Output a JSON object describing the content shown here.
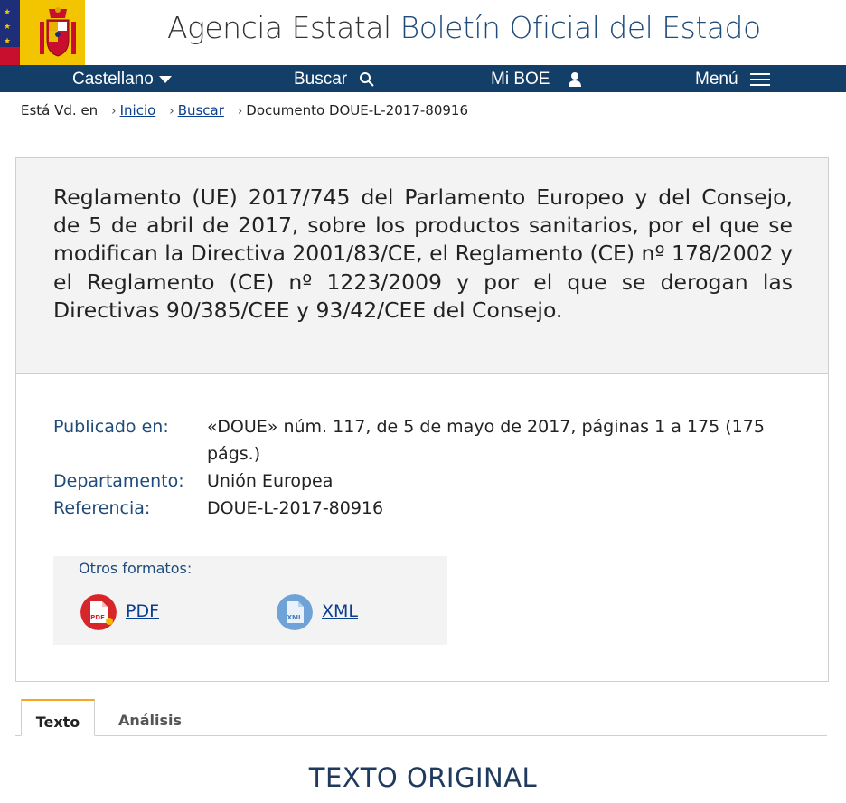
{
  "header": {
    "title_main": "Agencia Estatal",
    "title_accent": "Boletín Oficial del Estado"
  },
  "nav": {
    "language": "Castellano",
    "search": "Buscar",
    "my_boe": "Mi BOE",
    "menu": "Menú"
  },
  "breadcrumb": {
    "prefix": "Está Vd. en",
    "items": [
      "Inicio",
      "Buscar",
      "Documento DOUE-L-2017-80916"
    ]
  },
  "document": {
    "title": "Reglamento (UE) 2017/745 del Parlamento Europeo y del Consejo, de 5 de abril de 2017, sobre los productos sanitarios, por el que se modifican la Directiva 2001/83/CE, el Reglamento (CE) nº 178/2002 y el Reglamento (CE) nº 1223/2009 y por el que se derogan las Directivas 90/385/CEE y 93/42/CEE del Consejo.",
    "meta": [
      {
        "label": "Publicado en:",
        "value": "«DOUE» núm. 117, de 5 de mayo de 2017, páginas 1 a 175 (175 págs.)"
      },
      {
        "label": "Departamento:",
        "value": "Unión Europea"
      },
      {
        "label": "Referencia:",
        "value": "DOUE-L-2017-80916"
      }
    ],
    "formats": {
      "label": "Otros formatos:",
      "pdf": "PDF",
      "pdf_badge": "PDF",
      "xml": "XML",
      "xml_badge": "XML"
    }
  },
  "tabs": [
    "Texto",
    "Análisis"
  ],
  "section_heading": "TEXTO ORIGINAL",
  "colors": {
    "nav_bg": "#123e68",
    "accent_blue": "#1e4b7a",
    "link": "#0a3e8f",
    "tab_active_border": "#f5a623",
    "pdf_red": "#d7262b",
    "xml_blue": "#6fa3d8"
  }
}
